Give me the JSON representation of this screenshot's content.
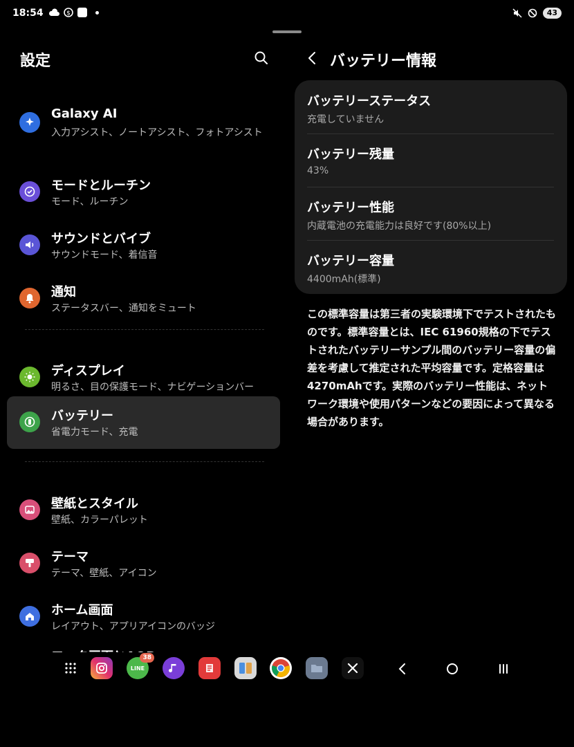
{
  "status": {
    "time": "18:54",
    "battery": "43"
  },
  "left": {
    "title": "設定",
    "items": [
      {
        "title": "Galaxy AI",
        "sub": "入力アシスト、ノートアシスト、フォトアシスト",
        "icon": "sparkle-icon",
        "color": "#2f6ee0"
      },
      {
        "title": "モードとルーチン",
        "sub": "モード、ルーチン",
        "icon": "check-circle-icon",
        "color": "#6a4fd8"
      },
      {
        "title": "サウンドとバイブ",
        "sub": "サウンドモード、着信音",
        "icon": "speaker-icon",
        "color": "#5a55d6"
      },
      {
        "title": "通知",
        "sub": "ステータスバー、通知をミュート",
        "icon": "bell-icon",
        "color": "#e0662f"
      },
      {
        "title": "ディスプレイ",
        "sub": "明るさ、目の保護モード、ナビゲーションバー",
        "icon": "sun-icon",
        "color": "#6bb82e"
      },
      {
        "title": "バッテリー",
        "sub": "省電力モード、充電",
        "icon": "battery-icon",
        "color": "#3da34a"
      },
      {
        "title": "壁紙とスタイル",
        "sub": "壁紙、カラーパレット",
        "icon": "picture-icon",
        "color": "#d94f7a"
      },
      {
        "title": "テーマ",
        "sub": "テーマ、壁紙、アイコン",
        "icon": "brush-icon",
        "color": "#d94f6a"
      },
      {
        "title": "ホーム画面",
        "sub": "レイアウト、アプリアイコンのバッジ",
        "icon": "home-icon",
        "color": "#3f6fe0"
      },
      {
        "title": "ロック画面とAOD",
        "sub": "",
        "icon": "lock-icon",
        "color": "#3f6fe0"
      }
    ]
  },
  "right": {
    "title": "バッテリー情報",
    "rows": [
      {
        "title": "バッテリーステータス",
        "sub": "充電していません"
      },
      {
        "title": "バッテリー残量",
        "sub": "43%"
      },
      {
        "title": "バッテリー性能",
        "sub": "内蔵電池の充電能力は良好です(80%以上)"
      },
      {
        "title": "バッテリー容量",
        "sub": "4400mAh(標準)"
      }
    ],
    "description": "この標準容量は第三者の実験環境下でテストされたものです。標準容量とは、IEC 61960規格の下でテストされたバッテリーサンプル間のバッテリー容量の偏差を考慮して推定された平均容量です。定格容量は4270mAhです。実際のバッテリー性能は、ネットワーク環境や使用パターンなどの要因によって異なる場合があります。"
  },
  "dock": {
    "line_badge": "38",
    "line_label": "LINE"
  }
}
